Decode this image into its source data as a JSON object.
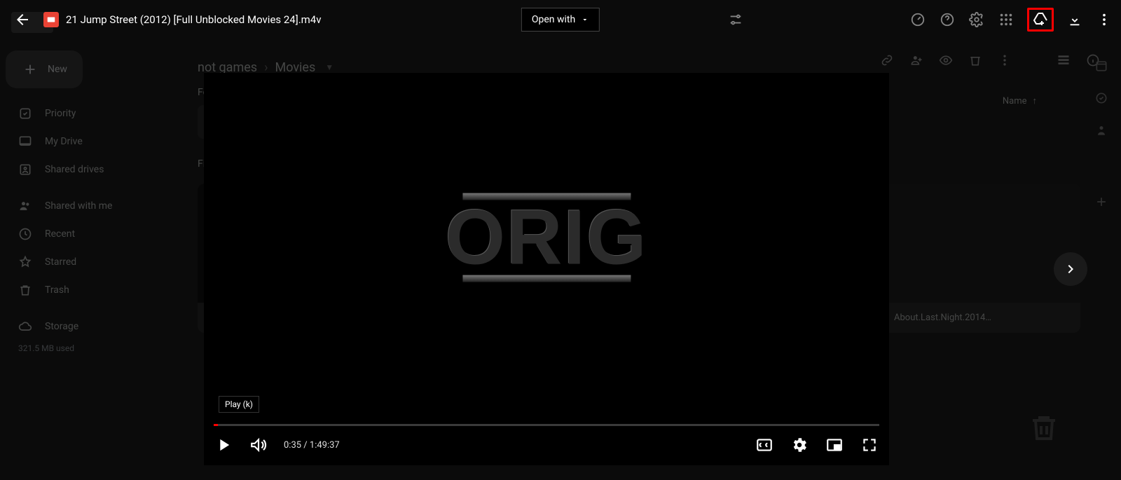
{
  "preview": {
    "title": "21 Jump Street (2012) [Full Unblocked Movies 24].m4v",
    "open_with": "Open with",
    "tooltip": "Play (k)",
    "time_elapsed": "0:35",
    "time_total": "1:49:37",
    "art_text": "ORIG"
  },
  "drive": {
    "new_label": "New",
    "nav": {
      "priority": "Priority",
      "my_drive": "My Drive",
      "shared_drives": "Shared drives",
      "shared_with_me": "Shared with me",
      "recent": "Recent",
      "starred": "Starred",
      "trash": "Trash",
      "storage": "Storage"
    },
    "storage_used": "321.5 MB used",
    "breadcrumb": {
      "a": "not games",
      "b": "Movies"
    },
    "sections": {
      "folders": "Folders",
      "files": "Files"
    },
    "column_name": "Name",
    "file_b": "About.Last.Night.2014…"
  }
}
